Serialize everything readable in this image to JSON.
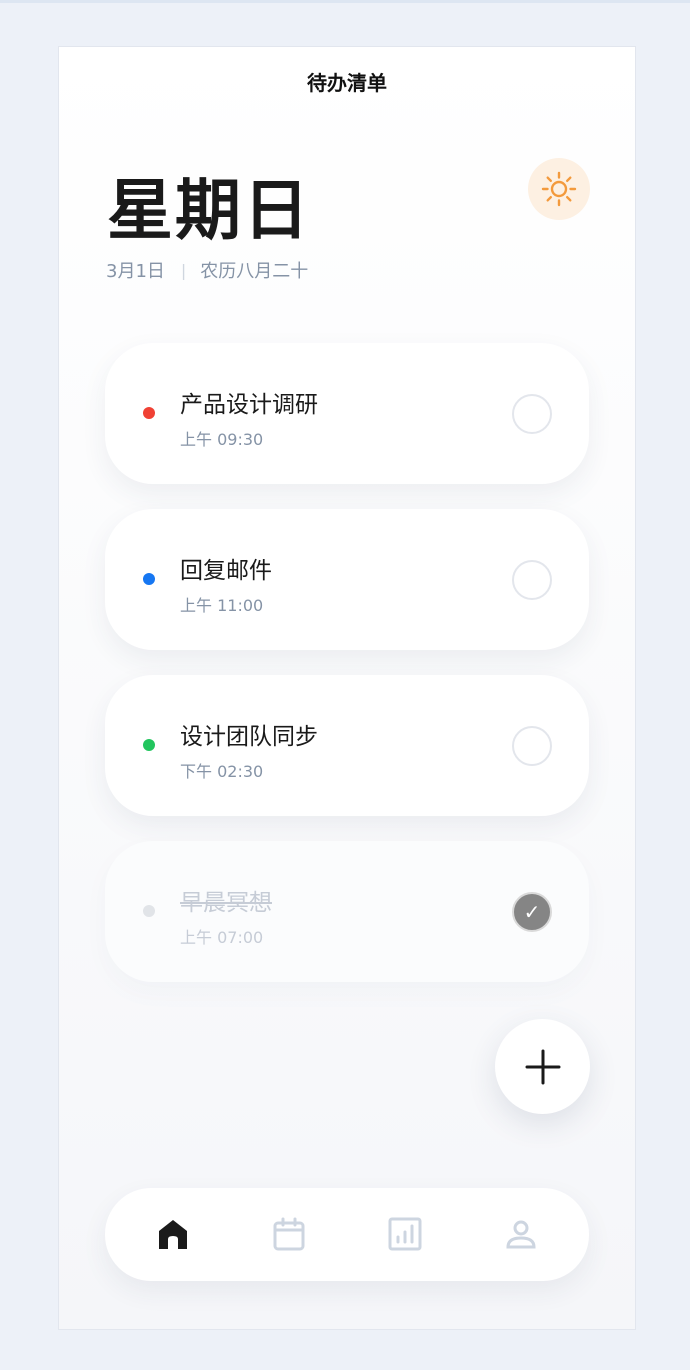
{
  "header": {
    "title": "待办清单"
  },
  "today": {
    "weekday": "星期日",
    "date": "3月1日",
    "separator": "|",
    "lunar": "农历八月二十"
  },
  "theme_toggle": {
    "icon": "sun-icon",
    "color": "#f39a3c"
  },
  "tasks": [
    {
      "title": "产品设计调研",
      "time": "上午 09:30",
      "color": "#f04134",
      "done": false
    },
    {
      "title": "回复邮件",
      "time": "上午 11:00",
      "color": "#1677f2",
      "done": false
    },
    {
      "title": "设计团队同步",
      "time": "下午 02:30",
      "color": "#22c55e",
      "done": false
    },
    {
      "title": "早晨冥想",
      "time": "上午 07:00",
      "color": "#e1e4e8",
      "done": true,
      "check_mark": "✓"
    }
  ],
  "fab": {
    "icon": "plus-icon"
  },
  "tabbar": {
    "items": [
      {
        "name": "home",
        "icon": "home-icon",
        "active": true
      },
      {
        "name": "calendar",
        "icon": "calendar-icon",
        "active": false
      },
      {
        "name": "stats",
        "icon": "bar-chart-icon",
        "active": false
      },
      {
        "name": "profile",
        "icon": "user-icon",
        "active": false
      }
    ],
    "active_color": "#1a1a1a",
    "inactive_color": "#cdd5e0"
  }
}
